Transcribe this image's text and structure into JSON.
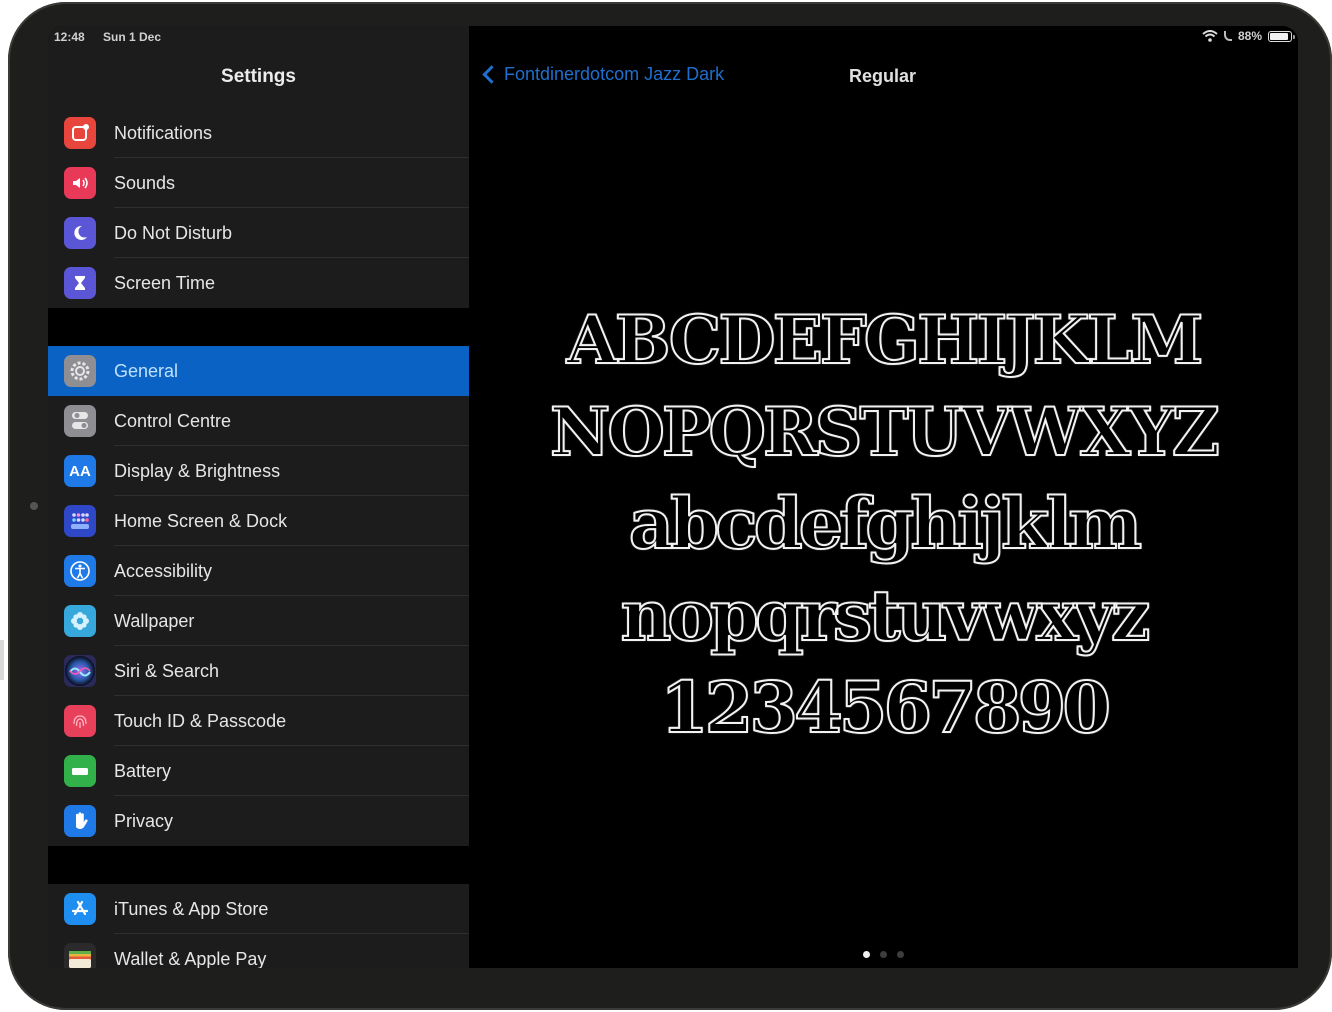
{
  "status_bar": {
    "time": "12:48",
    "date": "Sun 1 Dec",
    "battery_percent_label": "88%",
    "battery_level": 0.88,
    "icons": [
      "wifi-icon",
      "moon-icon",
      "battery-icon"
    ]
  },
  "sidebar": {
    "title": "Settings",
    "groups": [
      {
        "items": [
          {
            "label": "Notifications",
            "icon": "notifications-icon",
            "color": "#e8453c"
          },
          {
            "label": "Sounds",
            "icon": "speaker-icon",
            "color": "#e83a58"
          },
          {
            "label": "Do Not Disturb",
            "icon": "moon-icon",
            "color": "#5b56d6"
          },
          {
            "label": "Screen Time",
            "icon": "hourglass-icon",
            "color": "#5b56d6"
          }
        ]
      },
      {
        "items": [
          {
            "label": "General",
            "icon": "gear-icon",
            "color": "#8e8e93",
            "selected": true
          },
          {
            "label": "Control Centre",
            "icon": "toggles-icon",
            "color": "#8e8e93"
          },
          {
            "label": "Display & Brightness",
            "icon": "text-size-icon",
            "color": "#1f7ae8",
            "glyph": "AA"
          },
          {
            "label": "Home Screen & Dock",
            "icon": "grid-icon",
            "color": "#2f48c8"
          },
          {
            "label": "Accessibility",
            "icon": "accessibility-icon",
            "color": "#1f7ae8"
          },
          {
            "label": "Wallpaper",
            "icon": "flower-icon",
            "color": "#36a8dc"
          },
          {
            "label": "Siri & Search",
            "icon": "siri-icon",
            "color": "#2a2a5a"
          },
          {
            "label": "Touch ID & Passcode",
            "icon": "fingerprint-icon",
            "color": "#e8405a"
          },
          {
            "label": "Battery",
            "icon": "battery-icon",
            "color": "#32b14a"
          },
          {
            "label": "Privacy",
            "icon": "hand-icon",
            "color": "#1f7ae8"
          }
        ]
      },
      {
        "items": [
          {
            "label": "iTunes & App Store",
            "icon": "app-store-icon",
            "color": "#1e8ef0"
          },
          {
            "label": "Wallet & Apple Pay",
            "icon": "wallet-icon",
            "color": "#2a2a2a"
          }
        ]
      }
    ]
  },
  "detail": {
    "back_label": "Fontdinerdotcom Jazz Dark",
    "title": "Regular",
    "sample_lines": [
      "ABCDEFGHIJKLM",
      "NOPQRSTUVWXYZ",
      "abcdefghijklm",
      "nopqrstuvwxyz",
      "1234567890"
    ],
    "page_dots": {
      "count": 3,
      "active_index": 0
    }
  },
  "colors": {
    "accent": "#1e6fd0",
    "selection": "#0a63c4",
    "sidebar_bg": "#1c1c1c",
    "detail_bg": "#000000"
  }
}
